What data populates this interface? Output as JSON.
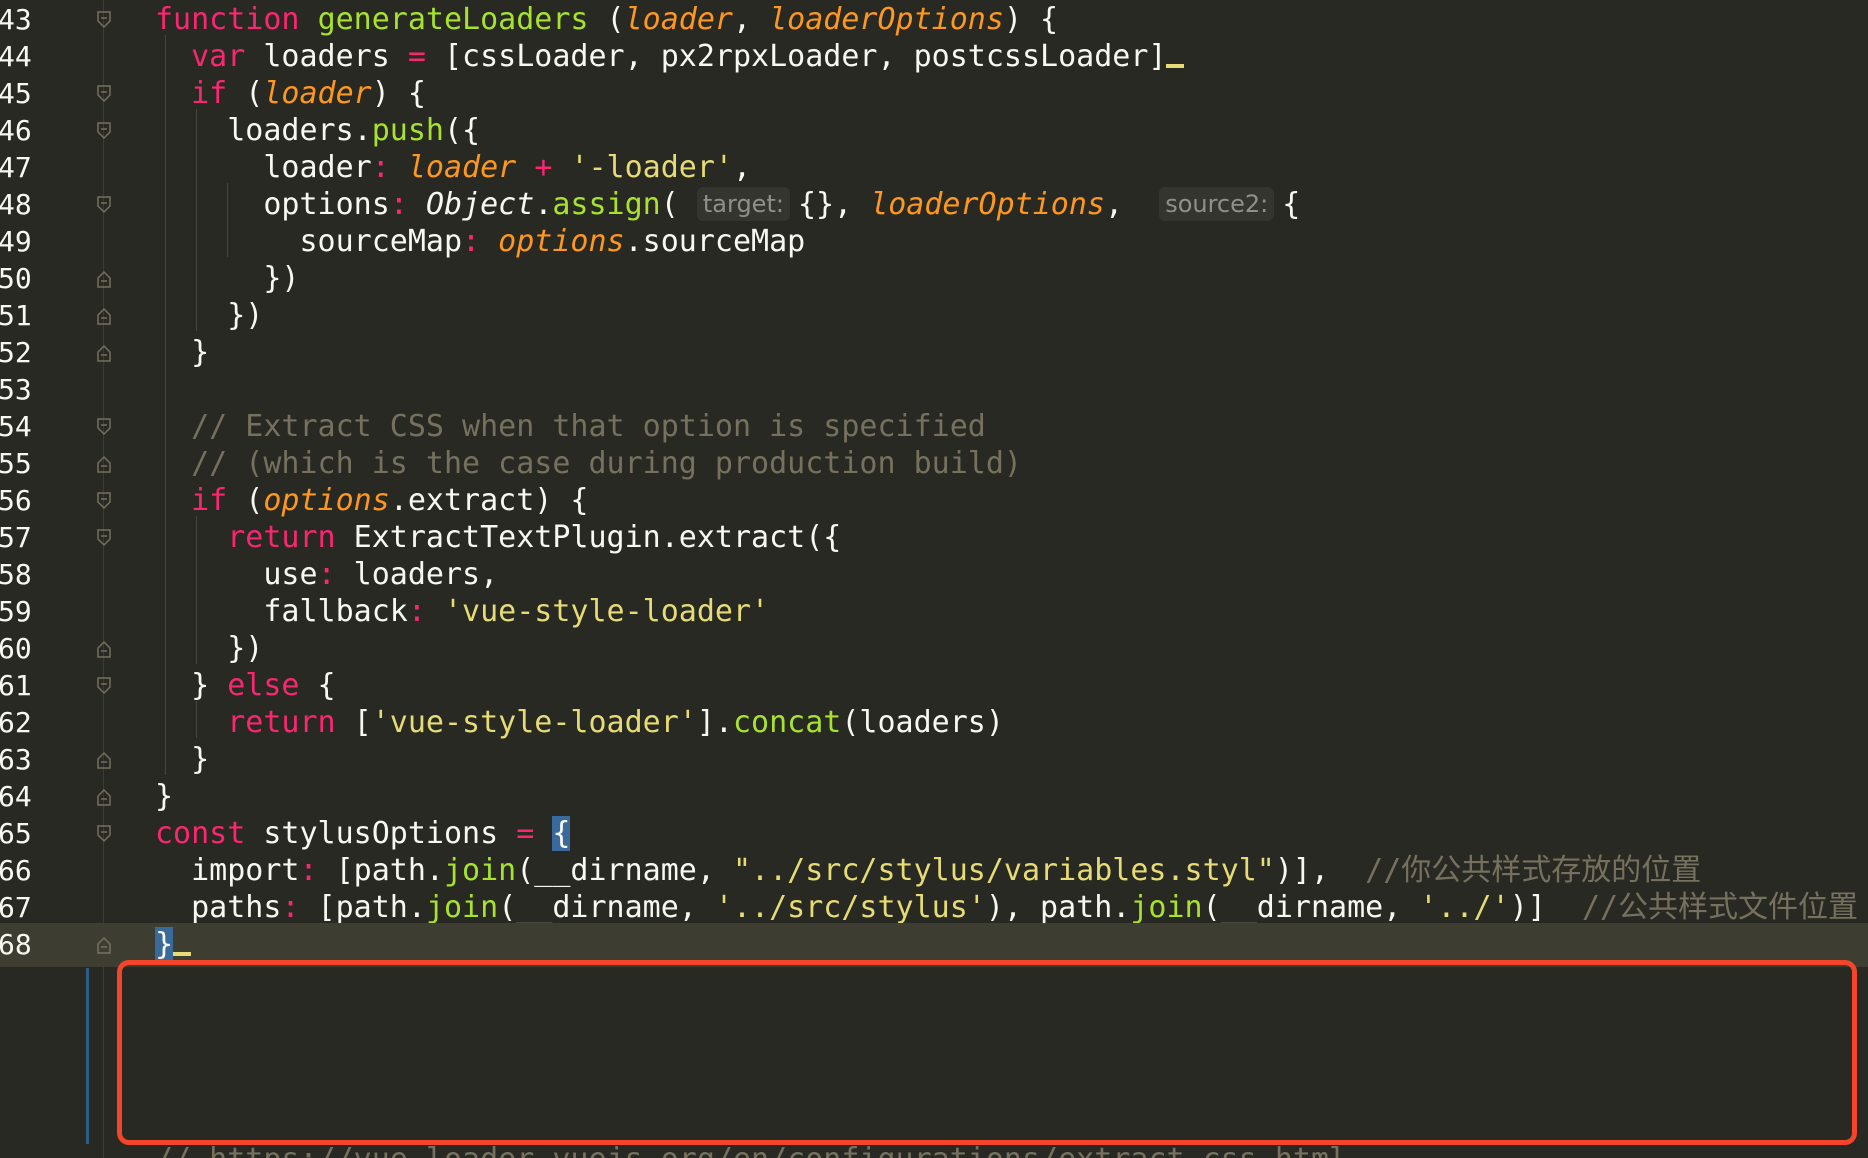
{
  "editor": {
    "lines": [
      {
        "num": "43",
        "fold": "open",
        "segments": [
          {
            "t": "function",
            "c": "kw"
          },
          {
            "t": " "
          },
          {
            "t": "generateLoaders",
            "c": "fn"
          },
          {
            "t": " ("
          },
          {
            "t": "loader",
            "c": "param"
          },
          {
            "t": ", "
          },
          {
            "t": "loaderOptions",
            "c": "param"
          },
          {
            "t": ") {"
          }
        ]
      },
      {
        "num": "44",
        "fold": "none",
        "segments": [
          {
            "t": "  "
          },
          {
            "t": "var",
            "c": "kw"
          },
          {
            "t": " loaders "
          },
          {
            "t": "=",
            "c": "op"
          },
          {
            "t": " [cssLoader, px2rpxLoader, postcssLoader]"
          },
          {
            "caret": true
          }
        ]
      },
      {
        "num": "45",
        "fold": "open",
        "segments": [
          {
            "t": "  "
          },
          {
            "t": "if",
            "c": "kw"
          },
          {
            "t": " ("
          },
          {
            "t": "loader",
            "c": "param"
          },
          {
            "t": ") {"
          }
        ]
      },
      {
        "num": "46",
        "fold": "open",
        "segments": [
          {
            "t": "    loaders."
          },
          {
            "t": "push",
            "c": "fn"
          },
          {
            "t": "({"
          }
        ]
      },
      {
        "num": "47",
        "fold": "none",
        "segments": [
          {
            "t": "      loader"
          },
          {
            "t": ":",
            "c": "op"
          },
          {
            "t": " "
          },
          {
            "t": "loader",
            "c": "param"
          },
          {
            "t": " "
          },
          {
            "t": "+",
            "c": "op"
          },
          {
            "t": " "
          },
          {
            "t": "'-loader'",
            "c": "str"
          },
          {
            "t": ","
          }
        ]
      },
      {
        "num": "48",
        "fold": "open",
        "segments": [
          {
            "t": "      options"
          },
          {
            "t": ":",
            "c": "op"
          },
          {
            "t": " "
          },
          {
            "t": "Object",
            "c": "it"
          },
          {
            "t": "."
          },
          {
            "t": "assign",
            "c": "fn"
          },
          {
            "t": "( "
          },
          {
            "hint": "target:"
          },
          {
            "t": "{}, "
          },
          {
            "t": "loaderOptions",
            "c": "param"
          },
          {
            "t": ",  "
          },
          {
            "hint": "source2:"
          },
          {
            "t": "{"
          }
        ]
      },
      {
        "num": "49",
        "fold": "none",
        "segments": [
          {
            "t": "        sourceMap"
          },
          {
            "t": ":",
            "c": "op"
          },
          {
            "t": " "
          },
          {
            "t": "options",
            "c": "param"
          },
          {
            "t": ".sourceMap"
          }
        ]
      },
      {
        "num": "50",
        "fold": "close",
        "segments": [
          {
            "t": "      })"
          }
        ]
      },
      {
        "num": "51",
        "fold": "close",
        "segments": [
          {
            "t": "    })"
          }
        ]
      },
      {
        "num": "52",
        "fold": "close",
        "segments": [
          {
            "t": "  }"
          }
        ]
      },
      {
        "num": "53",
        "fold": "none",
        "segments": []
      },
      {
        "num": "54",
        "fold": "open",
        "segments": [
          {
            "t": "  "
          },
          {
            "t": "// Extract CSS when that option is specified",
            "c": "cm"
          }
        ]
      },
      {
        "num": "55",
        "fold": "close",
        "segments": [
          {
            "t": "  "
          },
          {
            "t": "// (which is the case during production build)",
            "c": "cm"
          }
        ]
      },
      {
        "num": "56",
        "fold": "open",
        "segments": [
          {
            "t": "  "
          },
          {
            "t": "if",
            "c": "kw"
          },
          {
            "t": " ("
          },
          {
            "t": "options",
            "c": "param"
          },
          {
            "t": ".extract) {"
          }
        ]
      },
      {
        "num": "57",
        "fold": "open",
        "segments": [
          {
            "t": "    "
          },
          {
            "t": "return",
            "c": "kw"
          },
          {
            "t": " ExtractTextPlugin.extract({"
          }
        ]
      },
      {
        "num": "58",
        "fold": "none",
        "segments": [
          {
            "t": "      use"
          },
          {
            "t": ":",
            "c": "op"
          },
          {
            "t": " loaders,"
          }
        ]
      },
      {
        "num": "59",
        "fold": "none",
        "segments": [
          {
            "t": "      fallback"
          },
          {
            "t": ":",
            "c": "op"
          },
          {
            "t": " "
          },
          {
            "t": "'vue-style-loader'",
            "c": "str"
          }
        ]
      },
      {
        "num": "60",
        "fold": "close",
        "segments": [
          {
            "t": "    })"
          }
        ]
      },
      {
        "num": "61",
        "fold": "open",
        "segments": [
          {
            "t": "  } "
          },
          {
            "t": "else",
            "c": "kw"
          },
          {
            "t": " {"
          }
        ]
      },
      {
        "num": "62",
        "fold": "none",
        "segments": [
          {
            "t": "    "
          },
          {
            "t": "return",
            "c": "kw"
          },
          {
            "t": " ["
          },
          {
            "t": "'vue-style-loader'",
            "c": "str"
          },
          {
            "t": "]."
          },
          {
            "t": "concat",
            "c": "fn"
          },
          {
            "t": "(loaders)"
          }
        ]
      },
      {
        "num": "63",
        "fold": "close",
        "segments": [
          {
            "t": "  }"
          }
        ]
      },
      {
        "num": "64",
        "fold": "close",
        "segments": [
          {
            "t": "}"
          }
        ]
      },
      {
        "num": "65",
        "fold": "open",
        "segments": [
          {
            "t": "const",
            "c": "kw"
          },
          {
            "t": " stylusOptions "
          },
          {
            "t": "=",
            "c": "op"
          },
          {
            "t": " "
          },
          {
            "t": "{",
            "c": "bhl"
          }
        ]
      },
      {
        "num": "66",
        "fold": "none",
        "segments": [
          {
            "t": "  import"
          },
          {
            "t": ":",
            "c": "op"
          },
          {
            "t": " [path."
          },
          {
            "t": "join",
            "c": "fn"
          },
          {
            "t": "(__dirname, "
          },
          {
            "t": "\"../src/stylus/variables.styl\"",
            "c": "str"
          },
          {
            "t": ")],  "
          },
          {
            "t": "//你公共样式存放的位置",
            "c": "cm"
          }
        ]
      },
      {
        "num": "67",
        "fold": "none",
        "segments": [
          {
            "t": "  paths"
          },
          {
            "t": ":",
            "c": "op"
          },
          {
            "t": " [path."
          },
          {
            "t": "join",
            "c": "fn"
          },
          {
            "t": "(__dirname, "
          },
          {
            "t": "'../src/stylus'",
            "c": "str"
          },
          {
            "t": "), path."
          },
          {
            "t": "join",
            "c": "fn"
          },
          {
            "t": "(__dirname, "
          },
          {
            "t": "'../'",
            "c": "str"
          },
          {
            "t": ")]  "
          },
          {
            "t": "//公共样式文件位置",
            "c": "cm"
          }
        ]
      },
      {
        "num": "68",
        "fold": "close",
        "current": true,
        "segments": [
          {
            "t": "}",
            "c": "bhl"
          },
          {
            "caret": true
          }
        ]
      }
    ],
    "cutoff_text": "// https://vue-loader.vuejs.org/en/configurations/extract-css.html"
  },
  "colors": {
    "background": "#282923",
    "current_line": "#3e3d32",
    "keyword": "#f92672",
    "function": "#a6e22e",
    "parameter": "#fd971f",
    "string": "#e6db74",
    "comment": "#75715e",
    "highlight_box": "#f2452a"
  }
}
